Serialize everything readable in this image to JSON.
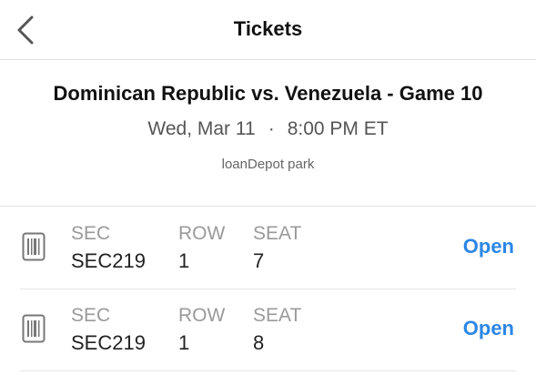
{
  "header": {
    "title": "Tickets",
    "back_icon": "chevron-left-icon"
  },
  "event": {
    "title": "Dominican Republic vs. Venezuela - Game 10",
    "date": "Wed, Mar 11",
    "separator": "·",
    "time": "8:00 PM ET",
    "venue": "loanDepot park"
  },
  "ticket_labels": {
    "sec": "SEC",
    "row": "ROW",
    "seat": "SEAT"
  },
  "tickets": [
    {
      "sec": "SEC219",
      "row": "1",
      "seat": "7",
      "action": "Open",
      "icon": "barcode-ticket-icon"
    },
    {
      "sec": "SEC219",
      "row": "1",
      "seat": "8",
      "action": "Open",
      "icon": "barcode-ticket-icon"
    }
  ],
  "colors": {
    "accent": "#2b86e6",
    "label_gray": "#9a9a9a",
    "divider": "#e2e2e2"
  }
}
